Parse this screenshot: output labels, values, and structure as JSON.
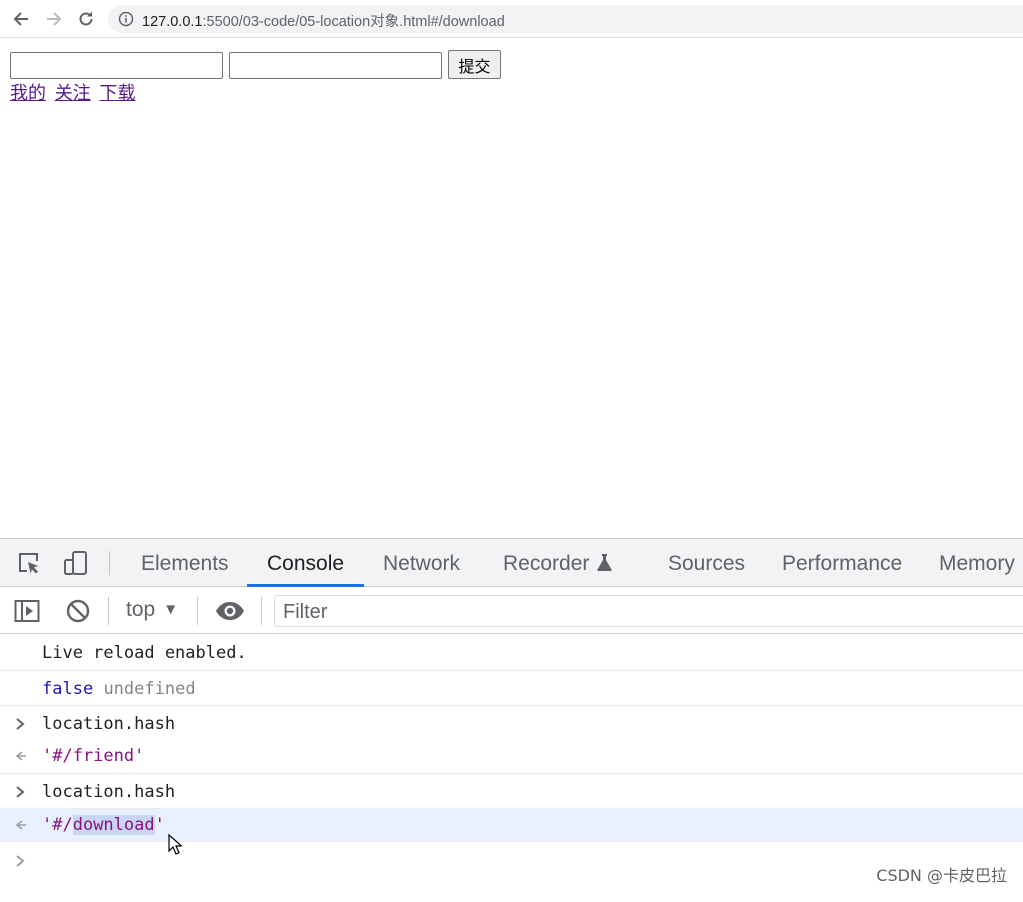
{
  "browser": {
    "url_host": "127.0.0.1",
    "url_rest": ":5500/03-code/05-location对象.html#/download"
  },
  "page": {
    "submit_label": "提交",
    "links": [
      "我的",
      "关注",
      "下载"
    ]
  },
  "devtools": {
    "tabs": [
      "Elements",
      "Console",
      "Network",
      "Recorder",
      "Sources",
      "Performance",
      "Memory"
    ],
    "active_tab": "Console",
    "context": "top",
    "filter_placeholder": "Filter",
    "console": [
      {
        "kind": "log",
        "text": "Live reload enabled."
      },
      {
        "kind": "log",
        "text_a": "false",
        "text_b": "undefined"
      },
      {
        "kind": "input",
        "text": "location.hash"
      },
      {
        "kind": "output",
        "text": "'#/friend'"
      },
      {
        "kind": "input",
        "text": "location.hash"
      },
      {
        "kind": "output",
        "text_pre": "'#/",
        "text_sel": "download",
        "text_post": "'"
      }
    ]
  },
  "watermark": "CSDN @卡皮巴拉",
  "colors": {
    "accent": "#1a73e8",
    "string": "#881280",
    "link_visited": "#551a8b"
  }
}
